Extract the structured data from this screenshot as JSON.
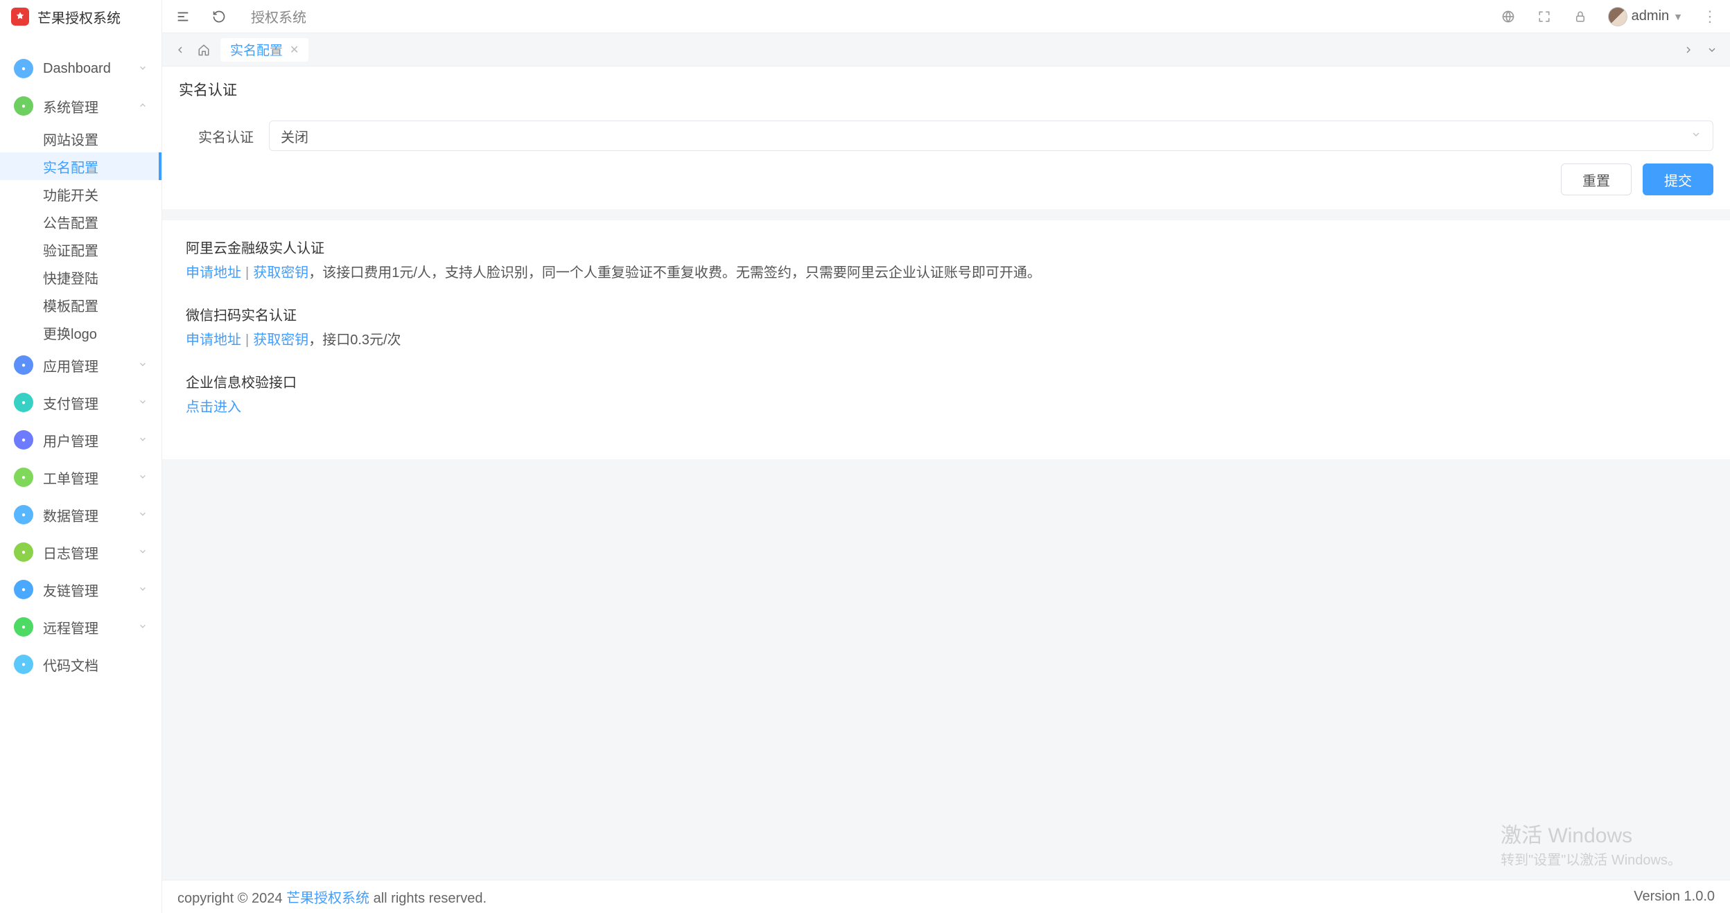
{
  "brand": "芒果授权系统",
  "header": {
    "breadcrumb": "授权系统",
    "user": "admin"
  },
  "nav": [
    {
      "label": "Dashboard",
      "color": "#5bb3ff",
      "chev": "down"
    },
    {
      "label": "系统管理",
      "color": "#6ecf61",
      "chev": "up",
      "open": true,
      "children": [
        "网站设置",
        "实名配置",
        "功能开关",
        "公告配置",
        "验证配置",
        "快捷登陆",
        "模板配置",
        "更换logo"
      ],
      "active": "实名配置"
    },
    {
      "label": "应用管理",
      "color": "#5b8ff9",
      "chev": "down"
    },
    {
      "label": "支付管理",
      "color": "#36d1c4",
      "chev": "down"
    },
    {
      "label": "用户管理",
      "color": "#6d7cff",
      "chev": "down"
    },
    {
      "label": "工单管理",
      "color": "#7fd85a",
      "chev": "down"
    },
    {
      "label": "数据管理",
      "color": "#58b6ff",
      "chev": "down"
    },
    {
      "label": "日志管理",
      "color": "#8bd24a",
      "chev": "down"
    },
    {
      "label": "友链管理",
      "color": "#4aa8ff",
      "chev": "down"
    },
    {
      "label": "远程管理",
      "color": "#4cd964",
      "chev": "down"
    },
    {
      "label": "代码文档",
      "color": "#5ac8fa"
    }
  ],
  "tabs": {
    "active": "实名配置"
  },
  "form": {
    "title": "实名认证",
    "label": "实名认证",
    "value": "关闭",
    "reset": "重置",
    "submit": "提交"
  },
  "info": [
    {
      "title": "阿里云金融级实人认证",
      "links": [
        "申请地址",
        "获取密钥"
      ],
      "text": "，该接口费用1元/人，支持人脸识别，同一个人重复验证不重复收费。无需签约，只需要阿里云企业认证账号即可开通。"
    },
    {
      "title": "微信扫码实名认证",
      "links": [
        "申请地址",
        "获取密钥"
      ],
      "text": "，接口0.3元/次"
    },
    {
      "title": "企业信息校验接口",
      "links": [
        "点击进入"
      ],
      "text": ""
    }
  ],
  "footer": {
    "copyright": "copyright © 2024 ",
    "brand": "芒果授权系统",
    "tail": " all rights reserved.",
    "version": "Version 1.0.0"
  },
  "watermark": {
    "l1": "激活 Windows",
    "l2": "转到\"设置\"以激活 Windows。"
  }
}
